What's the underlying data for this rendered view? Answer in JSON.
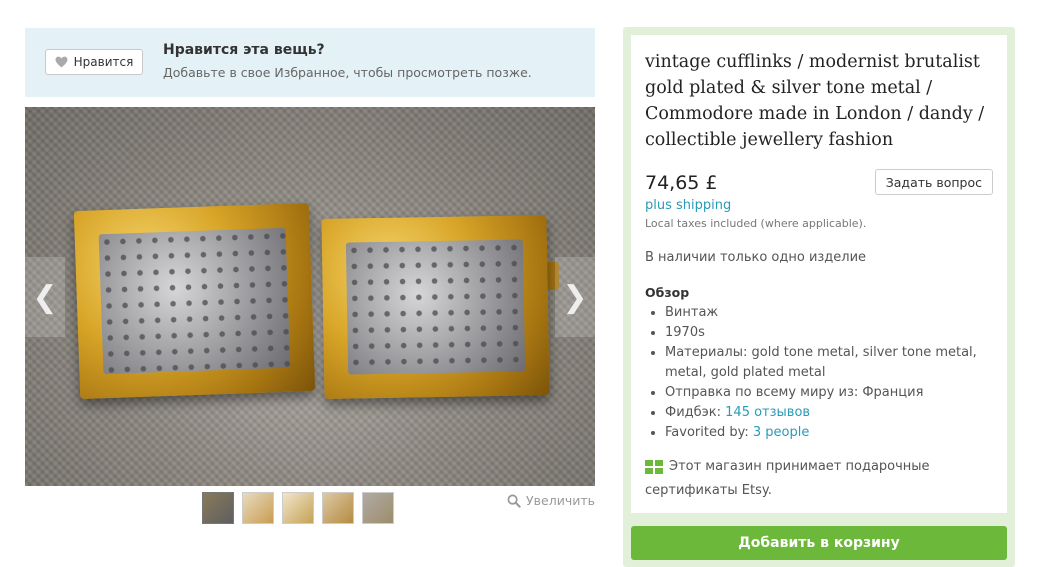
{
  "favorite_banner": {
    "like_button_label": "Нравится",
    "heading": "Нравится эта вещь?",
    "subtext": "Добавьте в свое Избранное, чтобы просмотреть позже."
  },
  "gallery": {
    "zoom_label": "Увеличить",
    "prev_icon": "chevron-left-icon",
    "next_icon": "chevron-right-icon",
    "thumbnail_count": 5
  },
  "listing": {
    "title": "vintage cufflinks / modernist brutalist gold plated & silver tone metal / Commodore made in London / dandy / collectible jewellery fashion",
    "price": "74,65 £",
    "ask_button": "Задать вопрос",
    "shipping": "plus shipping",
    "taxes_note": "Local taxes included (where applicable).",
    "stock_note": "В наличии только одно изделие",
    "overview_title": "Обзор",
    "overview": {
      "item1": "Винтаж",
      "item2": "1970s",
      "materials_label": "Материалы: ",
      "materials_value": "gold tone metal, silver tone metal, metal, gold plated metal",
      "shipping_from": "Отправка по всему миру из: Франция",
      "feedback_label": "Фидбэк: ",
      "feedback_link": "145 отзывов",
      "favorited_label": "Favorited by: ",
      "favorited_link": "3 people"
    },
    "gift_text": "Этот магазин принимает подарочные сертификаты Etsy.",
    "add_to_cart": "Добавить в корзину"
  },
  "colors": {
    "accent_link": "#2a9bb7",
    "cart_button": "#6cb83b",
    "banner_bg": "#e4f2f7",
    "panel_frame": "#e3f0d9"
  }
}
